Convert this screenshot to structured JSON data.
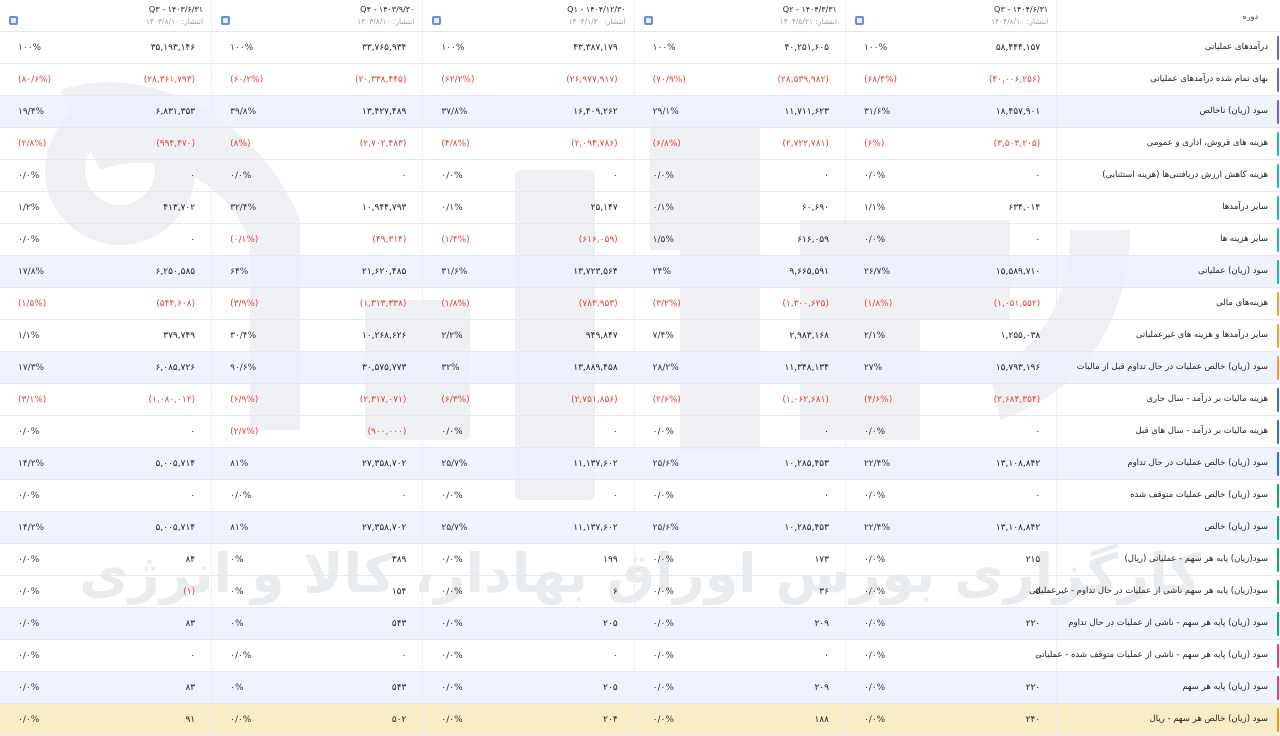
{
  "header": {
    "row_label": "دوره",
    "periods": [
      {
        "title": "Q۳ - ۱۴۰۳/۶/۳۱",
        "published": "انتشار: ۱۴۰۳/۸/۱۰"
      },
      {
        "title": "Q۴ - ۱۴۰۳/۹/۳۰",
        "published": "انتشار: ۱۴۰۳/۸/۱۰"
      },
      {
        "title": "Q۱ - ۱۴۰۴/۱۲/۳۰",
        "published": "انتشار: ۱۴۰۴/۱/۳۰"
      },
      {
        "title": "Q۲ - ۱۴۰۴/۳/۳۱",
        "published": "انتشار: ۱۴۰۴/۵/۲۱"
      },
      {
        "title": "Q۳ - ۱۴۰۴/۶/۳۱",
        "published": "انتشار: ۱۴۰۴/۸/۱۰"
      }
    ]
  },
  "rows": [
    {
      "label": "درآمدهای عملیاتی",
      "accent": "#7c5cc4",
      "cells": [
        {
          "v": "۳۵,۱۹۳,۱۴۶",
          "p": "۱۰۰%"
        },
        {
          "v": "۳۳,۷۶۵,۹۳۴",
          "p": "۱۰۰%"
        },
        {
          "v": "۴۳,۳۸۷,۱۷۹",
          "p": "۱۰۰%"
        },
        {
          "v": "۴۰,۲۵۱,۶۰۵",
          "p": "۱۰۰%"
        },
        {
          "v": "۵۸,۴۴۴,۱۵۷",
          "p": "۱۰۰%"
        }
      ]
    },
    {
      "label": "بهای تمام شده درآمدهای عملیاتی",
      "accent": "#7c5cc4",
      "cells": [
        {
          "v": "(۲۸,۳۶۱,۷۹۳)",
          "p": "(۸۰/۶%)",
          "n": true
        },
        {
          "v": "(۲۰,۳۳۸,۴۴۵)",
          "p": "(۶۰/۲%)",
          "n": true
        },
        {
          "v": "(۲۶,۹۷۷,۹۱۷)",
          "p": "(۶۲/۲%)",
          "n": true
        },
        {
          "v": "(۲۸,۵۳۹,۹۸۲)",
          "p": "(۷۰/۹%)",
          "n": true
        },
        {
          "v": "(۴۰,۰۰۶,۲۵۶)",
          "p": "(۶۸/۴%)",
          "n": true
        }
      ]
    },
    {
      "label": "سود (زیان) ناخالص",
      "accent": "#7c5cc4",
      "alt": true,
      "cells": [
        {
          "v": "۶,۸۳۱,۳۵۳",
          "p": "۱۹/۴%"
        },
        {
          "v": "۱۳,۴۲۷,۴۸۹",
          "p": "۳۹/۸%"
        },
        {
          "v": "۱۶,۴۰۹,۲۶۲",
          "p": "۳۷/۸%"
        },
        {
          "v": "۱۱,۷۱۱,۶۲۳",
          "p": "۲۹/۱%"
        },
        {
          "v": "۱۸,۴۵۷,۹۰۱",
          "p": "۳۱/۶%"
        }
      ]
    },
    {
      "label": "هزینه های فروش، اداری و عمومی",
      "accent": "#22b0c9",
      "cells": [
        {
          "v": "(۹۹۴,۴۷۰)",
          "p": "(۲/۸%)",
          "n": true
        },
        {
          "v": "(۲,۷۰۲,۴۸۳)",
          "p": "(۸%)",
          "n": true
        },
        {
          "v": "(۲,۰۹۴,۷۸۶)",
          "p": "(۴/۸%)",
          "n": true
        },
        {
          "v": "(۲,۷۲۲,۷۸۱)",
          "p": "(۶/۸%)",
          "n": true
        },
        {
          "v": "(۳,۵۰۳,۲۰۵)",
          "p": "(۶%)",
          "n": true
        }
      ]
    },
    {
      "label": "هزینه کاهش ارزش دریافتنی‌ها (هزینه استثنایی)",
      "accent": "#22b0c9",
      "cells": [
        {
          "v": "۰",
          "p": "۰/۰%"
        },
        {
          "v": "۰",
          "p": "۰/۰%"
        },
        {
          "v": "۰",
          "p": "۰/۰%"
        },
        {
          "v": "۰",
          "p": "۰/۰%"
        },
        {
          "v": "۰",
          "p": "۰/۰%"
        }
      ]
    },
    {
      "label": "سایر درآمدها",
      "accent": "#22b0c9",
      "cells": [
        {
          "v": "۴۱۳,۷۰۲",
          "p": "۱/۲%"
        },
        {
          "v": "۱۰,۹۴۴,۷۹۳",
          "p": "۳۲/۴%"
        },
        {
          "v": "۲۵,۱۴۷",
          "p": "۰/۱%"
        },
        {
          "v": "۶۰,۶۹۰",
          "p": "۰/۱%"
        },
        {
          "v": "۶۳۴,۰۱۴",
          "p": "۱/۱%"
        }
      ]
    },
    {
      "label": "سایر هزینه ها",
      "accent": "#22b0c9",
      "cells": [
        {
          "v": "۰",
          "p": "۰/۰%"
        },
        {
          "v": "(۴۹,۳۱۴)",
          "p": "(۰/۱%)",
          "n": true
        },
        {
          "v": "(۶۱۶,۰۵۹)",
          "p": "(۱/۴%)",
          "n": true
        },
        {
          "v": "۶۱۶,۰۵۹",
          "p": "۱/۵%"
        },
        {
          "v": "۰",
          "p": "۰/۰%"
        }
      ]
    },
    {
      "label": "سود (زیان) عملیاتی",
      "accent": "#22b0c9",
      "alt": true,
      "cells": [
        {
          "v": "۶,۲۵۰,۵۸۵",
          "p": "۱۷/۸%"
        },
        {
          "v": "۲۱,۶۲۰,۴۸۵",
          "p": "۶۴%"
        },
        {
          "v": "۱۳,۷۲۳,۵۶۴",
          "p": "۳۱/۶%"
        },
        {
          "v": "۹,۶۶۵,۵۹۱",
          "p": "۲۴%"
        },
        {
          "v": "۱۵,۵۸۹,۷۱۰",
          "p": "۲۶/۷%"
        }
      ]
    },
    {
      "label": "هزینه‌های مالی",
      "accent": "#f0a020",
      "cells": [
        {
          "v": "(۵۴۴,۶۰۸)",
          "p": "(۱/۵%)",
          "n": true
        },
        {
          "v": "(۱,۳۱۳,۳۳۸)",
          "p": "(۳/۹%)",
          "n": true
        },
        {
          "v": "(۷۸۳,۹۵۳)",
          "p": "(۱/۸%)",
          "n": true
        },
        {
          "v": "(۱,۳۰۰,۶۲۵)",
          "p": "(۳/۲%)",
          "n": true
        },
        {
          "v": "(۱,۰۵۱,۵۵۲)",
          "p": "(۱/۸%)",
          "n": true
        }
      ]
    },
    {
      "label": "سایر درآمدها و هزینه های غیرعملیاتی",
      "accent": "#f0a020",
      "cells": [
        {
          "v": "۳۷۹,۷۴۹",
          "p": "۱/۱%"
        },
        {
          "v": "۱۰,۲۶۸,۶۲۶",
          "p": "۳۰/۴%"
        },
        {
          "v": "۹۴۹,۸۴۷",
          "p": "۲/۲%"
        },
        {
          "v": "۲,۹۸۳,۱۶۸",
          "p": "۷/۴%"
        },
        {
          "v": "۱,۲۵۵,۰۳۸",
          "p": "۲/۱%"
        }
      ]
    },
    {
      "label": "سود (زیان) خالص عملیات در حال تداوم قبل از مالیات",
      "accent": "#f0a020",
      "alt": true,
      "cells": [
        {
          "v": "۶,۰۸۵,۷۲۶",
          "p": "۱۷/۳%"
        },
        {
          "v": "۳۰,۵۷۵,۷۷۳",
          "p": "۹۰/۶%"
        },
        {
          "v": "۱۳,۸۸۹,۴۵۸",
          "p": "۳۲%"
        },
        {
          "v": "۱۱,۳۴۸,۱۳۴",
          "p": "۲۸/۲%"
        },
        {
          "v": "۱۵,۷۹۳,۱۹۶",
          "p": "۲۷%"
        }
      ]
    },
    {
      "label": "هزینه مالیات بر درآمد - سال جاری",
      "accent": "#2f6fd0",
      "cells": [
        {
          "v": "(۱,۰۸۰,۰۱۲)",
          "p": "(۳/۱%)",
          "n": true
        },
        {
          "v": "(۲,۳۱۷,۰۷۱)",
          "p": "(۶/۹%)",
          "n": true
        },
        {
          "v": "(۲,۷۵۱,۸۵۶)",
          "p": "(۶/۳%)",
          "n": true
        },
        {
          "v": "(۱,۰۶۲,۶۸۱)",
          "p": "(۲/۶%)",
          "n": true
        },
        {
          "v": "(۲,۶۸۴,۳۵۴)",
          "p": "(۴/۶%)",
          "n": true
        }
      ]
    },
    {
      "label": "هزینه مالیات بر درآمد - سال های قبل",
      "accent": "#2f6fd0",
      "cells": [
        {
          "v": "۰",
          "p": "۰/۰%"
        },
        {
          "v": "(۹۰۰,۰۰۰)",
          "p": "(۲/۷%)",
          "n": true
        },
        {
          "v": "۰",
          "p": "۰/۰%"
        },
        {
          "v": "۰",
          "p": "۰/۰%"
        },
        {
          "v": "۰",
          "p": "۰/۰%"
        }
      ]
    },
    {
      "label": "سود (زیان) خالص عملیات در حال تداوم",
      "accent": "#2f6fd0",
      "alt": true,
      "cells": [
        {
          "v": "۵,۰۰۵,۷۱۴",
          "p": "۱۴/۲%"
        },
        {
          "v": "۲۷,۳۵۸,۷۰۲",
          "p": "۸۱%"
        },
        {
          "v": "۱۱,۱۳۷,۶۰۲",
          "p": "۲۵/۷%"
        },
        {
          "v": "۱۰,۲۸۵,۴۵۳",
          "p": "۲۵/۶%"
        },
        {
          "v": "۱۳,۱۰۸,۸۴۲",
          "p": "۲۲/۴%"
        }
      ]
    },
    {
      "label": "سود (زیان) خالص عملیات متوقف شده",
      "accent": "#17a06a",
      "cells": [
        {
          "v": "۰",
          "p": "۰/۰%"
        },
        {
          "v": "۰",
          "p": "۰/۰%"
        },
        {
          "v": "۰",
          "p": "۰/۰%"
        },
        {
          "v": "۰",
          "p": "۰/۰%"
        },
        {
          "v": "۰",
          "p": "۰/۰%"
        }
      ]
    },
    {
      "label": "سود (زیان) خالص",
      "accent": "#17a06a",
      "alt": true,
      "cells": [
        {
          "v": "۵,۰۰۵,۷۱۴",
          "p": "۱۴/۲%"
        },
        {
          "v": "۲۷,۳۵۸,۷۰۲",
          "p": "۸۱%"
        },
        {
          "v": "۱۱,۱۳۷,۶۰۲",
          "p": "۲۵/۷%"
        },
        {
          "v": "۱۰,۲۸۵,۴۵۳",
          "p": "۲۵/۶%"
        },
        {
          "v": "۱۳,۱۰۸,۸۴۲",
          "p": "۲۲/۴%"
        }
      ]
    },
    {
      "label": "سود(زیان) پایه هر سهم - عملیاتی (ریال)",
      "accent": "#17a06a",
      "cells": [
        {
          "v": "۸۴",
          "p": "۰/۰%"
        },
        {
          "v": "۳۸۹",
          "p": "۰%"
        },
        {
          "v": "۱۹۹",
          "p": "۰/۰%"
        },
        {
          "v": "۱۷۳",
          "p": "۰/۰%"
        },
        {
          "v": "۲۱۵",
          "p": "۰/۰%"
        }
      ]
    },
    {
      "label": "سود(زیان) پایه هر سهم ناشی از عملیات در حال تداوم - غیرعملیاتی",
      "accent": "#17a06a",
      "cells": [
        {
          "v": "(۱)",
          "p": "۰/۰%",
          "vn": true
        },
        {
          "v": "۱۵۴",
          "p": "۰%"
        },
        {
          "v": "۶",
          "p": "۰/۰%"
        },
        {
          "v": "۳۶",
          "p": "۰/۰%"
        },
        {
          "v": "۵",
          "p": "۰/۰%"
        }
      ]
    },
    {
      "label": "سود (زیان) پایه هر سهم - ناشی از عملیات در حال تداوم",
      "accent": "#17a06a",
      "alt": true,
      "cells": [
        {
          "v": "۸۳",
          "p": "۰/۰%"
        },
        {
          "v": "۵۴۳",
          "p": "۰%"
        },
        {
          "v": "۲۰۵",
          "p": "۰/۰%"
        },
        {
          "v": "۲۰۹",
          "p": "۰/۰%"
        },
        {
          "v": "۲۲۰",
          "p": "۰/۰%"
        }
      ]
    },
    {
      "label": "سود (زیان) پایه هر سهم - ناشی از عملیات متوقف شده - عملیاتی",
      "accent": "#e0457a",
      "cells": [
        {
          "v": "۰",
          "p": "۰/۰%"
        },
        {
          "v": "۰",
          "p": "۰/۰%"
        },
        {
          "v": "۰",
          "p": "۰/۰%"
        },
        {
          "v": "۰",
          "p": "۰/۰%"
        },
        {
          "v": "۰",
          "p": "۰/۰%"
        }
      ]
    },
    {
      "label": "سود (زیان) پایه هر سهم",
      "accent": "#e0457a",
      "alt": true,
      "cells": [
        {
          "v": "۸۳",
          "p": "۰/۰%"
        },
        {
          "v": "۵۴۳",
          "p": "۰%"
        },
        {
          "v": "۲۰۵",
          "p": "۰/۰%"
        },
        {
          "v": "۲۰۹",
          "p": "۰/۰%"
        },
        {
          "v": "۲۲۰",
          "p": "۰/۰%"
        }
      ]
    },
    {
      "label": "سود (زیان) خالص هر سهم - ریال",
      "accent": "#e0a020",
      "last": true,
      "cells": [
        {
          "v": "۹۱",
          "p": "۰/۰%"
        },
        {
          "v": "۵۰۲",
          "p": "۰/۰%"
        },
        {
          "v": "۲۰۴",
          "p": "۰/۰%"
        },
        {
          "v": "۱۸۸",
          "p": "۰/۰%"
        },
        {
          "v": "۲۴۰",
          "p": "۰/۰%"
        }
      ]
    }
  ],
  "watermark": {
    "text": "کارگزاری بورس اوراق بهادار، کالا و انرژی",
    "color": "#cfd4da"
  },
  "colors": {
    "negative": "#e0453a",
    "alt_row": "#eaf0fc",
    "last_row": "#f8edc6",
    "badge": "#6b8fd6"
  }
}
